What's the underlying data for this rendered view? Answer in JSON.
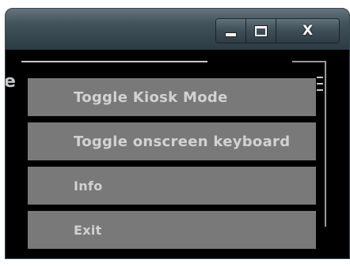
{
  "window": {
    "caption_buttons": {
      "close_label": "X"
    }
  },
  "background_fragment": {
    "text": "e"
  },
  "menu": {
    "items": [
      {
        "label": "Toggle Kiosk Mode"
      },
      {
        "label": "Toggle onscreen keyboard"
      },
      {
        "label": "Info"
      },
      {
        "label": "Exit"
      }
    ]
  },
  "colors": {
    "titlebar": "#3e4f58",
    "content_background": "#000000",
    "menu_item_background": "#797979",
    "menu_item_text": "#d2d2d2"
  },
  "icons": [
    "minimize-icon",
    "maximize-icon",
    "close-icon"
  ]
}
